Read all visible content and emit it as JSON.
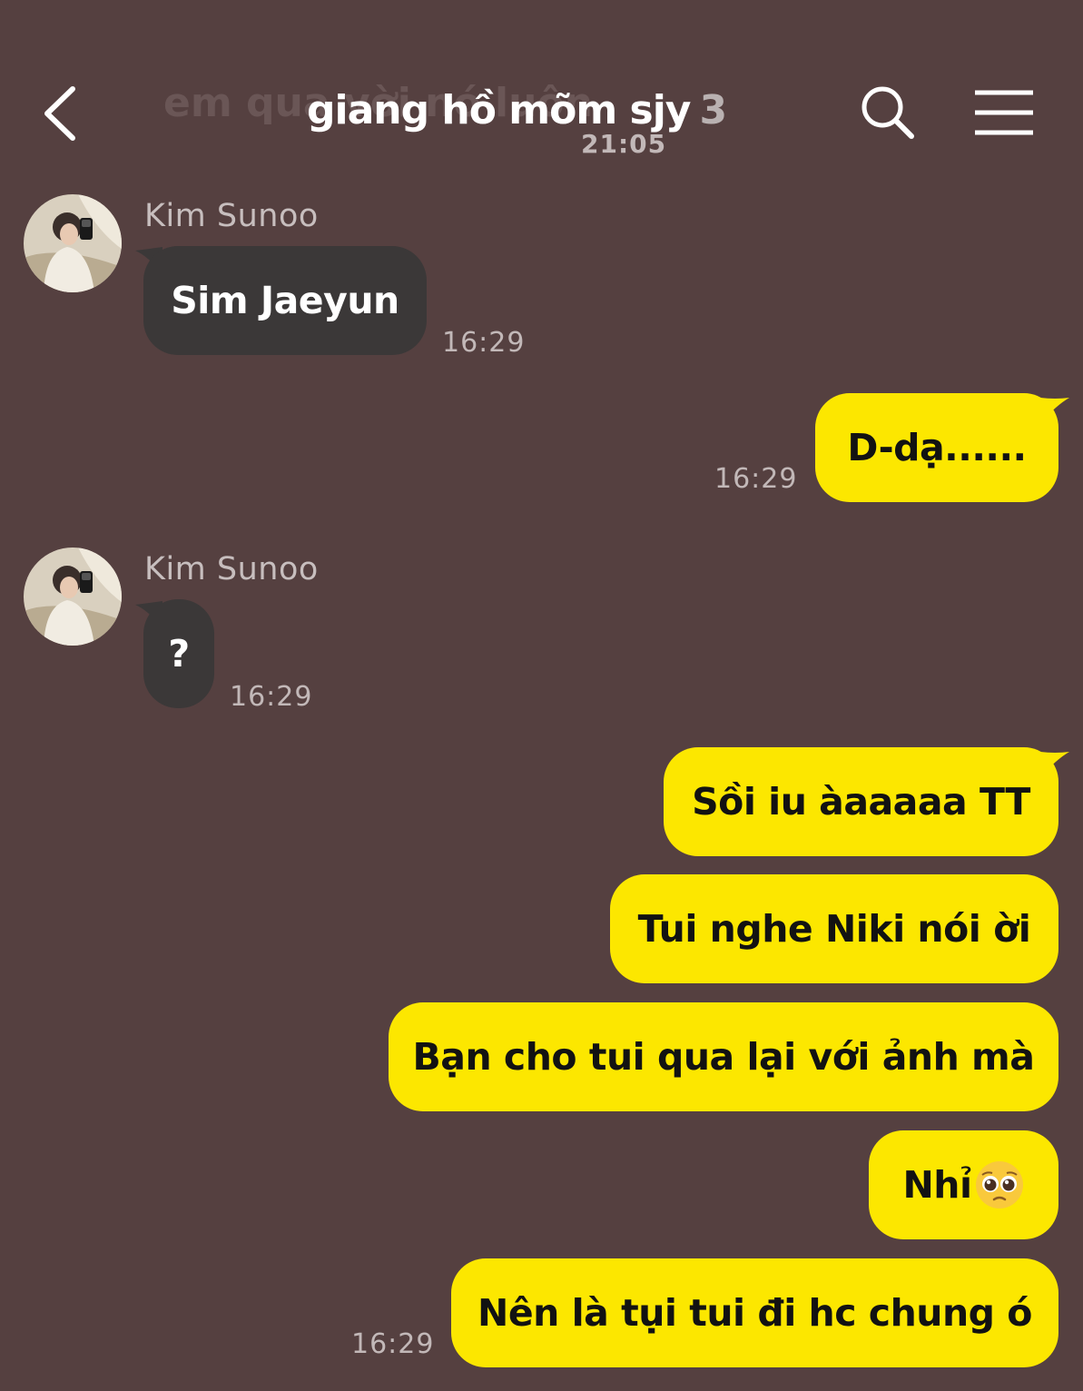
{
  "header": {
    "background_text": "em qua vời nó luôn",
    "background_time": "21:05",
    "title": "giang hồ mõm sjy",
    "member_count": "3",
    "back_icon": "chevron-left-icon",
    "search_icon": "search-icon",
    "menu_icon": "hamburger-menu-icon"
  },
  "colors": {
    "background": "#554040",
    "incoming": "#3b3838",
    "outgoing": "#fce700"
  },
  "messages": [
    {
      "sender": "Kim Sunoo",
      "text": "Sim Jaeyun",
      "time": "16:29",
      "direction": "in"
    },
    {
      "text": "D-dạ......",
      "time": "16:29",
      "direction": "out"
    },
    {
      "sender": "Kim Sunoo",
      "text": "?",
      "time": "16:29",
      "direction": "in"
    },
    {
      "text": "Sồi iu àaaaaa TT",
      "direction": "out"
    },
    {
      "text": "Tui nghe Niki nói ời",
      "direction": "out"
    },
    {
      "text": "Bạn cho tui qua lại với ảnh mà",
      "direction": "out"
    },
    {
      "text": "Nhỉ",
      "emoji": "pleading-face-icon",
      "direction": "out"
    },
    {
      "text": "Nên là tụi tui đi hc chung ó",
      "time": "16:29",
      "direction": "out"
    }
  ]
}
